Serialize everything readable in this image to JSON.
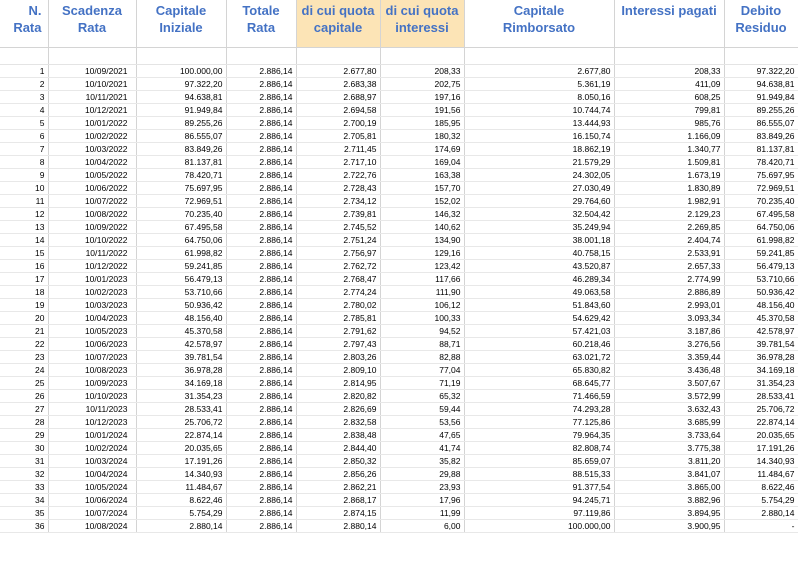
{
  "headers": [
    [
      "N.",
      "Rata"
    ],
    [
      "Scadenza",
      "Rata"
    ],
    [
      "Capitale",
      "Iniziale"
    ],
    [
      "Totale",
      "Rata"
    ],
    [
      "di cui quota",
      "capitale"
    ],
    [
      "di cui quota",
      "interessi"
    ],
    [
      "Capitale",
      "Rimborsato"
    ],
    [
      "Interessi pagati",
      ""
    ],
    [
      "Debito",
      "Residuo"
    ]
  ],
  "highlight_color": "#fce4b6",
  "header_color": "#4472c4",
  "rows": [
    [
      "1",
      "10/09/2021",
      "100.000,00",
      "2.886,14",
      "2.677,80",
      "208,33",
      "2.677,80",
      "208,33",
      "97.322,20"
    ],
    [
      "2",
      "10/10/2021",
      "97.322,20",
      "2.886,14",
      "2.683,38",
      "202,75",
      "5.361,19",
      "411,09",
      "94.638,81"
    ],
    [
      "3",
      "10/11/2021",
      "94.638,81",
      "2.886,14",
      "2.688,97",
      "197,16",
      "8.050,16",
      "608,25",
      "91.949,84"
    ],
    [
      "4",
      "10/12/2021",
      "91.949,84",
      "2.886,14",
      "2.694,58",
      "191,56",
      "10.744,74",
      "799,81",
      "89.255,26"
    ],
    [
      "5",
      "10/01/2022",
      "89.255,26",
      "2.886,14",
      "2.700,19",
      "185,95",
      "13.444,93",
      "985,76",
      "86.555,07"
    ],
    [
      "6",
      "10/02/2022",
      "86.555,07",
      "2.886,14",
      "2.705,81",
      "180,32",
      "16.150,74",
      "1.166,09",
      "83.849,26"
    ],
    [
      "7",
      "10/03/2022",
      "83.849,26",
      "2.886,14",
      "2.711,45",
      "174,69",
      "18.862,19",
      "1.340,77",
      "81.137,81"
    ],
    [
      "8",
      "10/04/2022",
      "81.137,81",
      "2.886,14",
      "2.717,10",
      "169,04",
      "21.579,29",
      "1.509,81",
      "78.420,71"
    ],
    [
      "9",
      "10/05/2022",
      "78.420,71",
      "2.886,14",
      "2.722,76",
      "163,38",
      "24.302,05",
      "1.673,19",
      "75.697,95"
    ],
    [
      "10",
      "10/06/2022",
      "75.697,95",
      "2.886,14",
      "2.728,43",
      "157,70",
      "27.030,49",
      "1.830,89",
      "72.969,51"
    ],
    [
      "11",
      "10/07/2022",
      "72.969,51",
      "2.886,14",
      "2.734,12",
      "152,02",
      "29.764,60",
      "1.982,91",
      "70.235,40"
    ],
    [
      "12",
      "10/08/2022",
      "70.235,40",
      "2.886,14",
      "2.739,81",
      "146,32",
      "32.504,42",
      "2.129,23",
      "67.495,58"
    ],
    [
      "13",
      "10/09/2022",
      "67.495,58",
      "2.886,14",
      "2.745,52",
      "140,62",
      "35.249,94",
      "2.269,85",
      "64.750,06"
    ],
    [
      "14",
      "10/10/2022",
      "64.750,06",
      "2.886,14",
      "2.751,24",
      "134,90",
      "38.001,18",
      "2.404,74",
      "61.998,82"
    ],
    [
      "15",
      "10/11/2022",
      "61.998,82",
      "2.886,14",
      "2.756,97",
      "129,16",
      "40.758,15",
      "2.533,91",
      "59.241,85"
    ],
    [
      "16",
      "10/12/2022",
      "59.241,85",
      "2.886,14",
      "2.762,72",
      "123,42",
      "43.520,87",
      "2.657,33",
      "56.479,13"
    ],
    [
      "17",
      "10/01/2023",
      "56.479,13",
      "2.886,14",
      "2.768,47",
      "117,66",
      "46.289,34",
      "2.774,99",
      "53.710,66"
    ],
    [
      "18",
      "10/02/2023",
      "53.710,66",
      "2.886,14",
      "2.774,24",
      "111,90",
      "49.063,58",
      "2.886,89",
      "50.936,42"
    ],
    [
      "19",
      "10/03/2023",
      "50.936,42",
      "2.886,14",
      "2.780,02",
      "106,12",
      "51.843,60",
      "2.993,01",
      "48.156,40"
    ],
    [
      "20",
      "10/04/2023",
      "48.156,40",
      "2.886,14",
      "2.785,81",
      "100,33",
      "54.629,42",
      "3.093,34",
      "45.370,58"
    ],
    [
      "21",
      "10/05/2023",
      "45.370,58",
      "2.886,14",
      "2.791,62",
      "94,52",
      "57.421,03",
      "3.187,86",
      "42.578,97"
    ],
    [
      "22",
      "10/06/2023",
      "42.578,97",
      "2.886,14",
      "2.797,43",
      "88,71",
      "60.218,46",
      "3.276,56",
      "39.781,54"
    ],
    [
      "23",
      "10/07/2023",
      "39.781,54",
      "2.886,14",
      "2.803,26",
      "82,88",
      "63.021,72",
      "3.359,44",
      "36.978,28"
    ],
    [
      "24",
      "10/08/2023",
      "36.978,28",
      "2.886,14",
      "2.809,10",
      "77,04",
      "65.830,82",
      "3.436,48",
      "34.169,18"
    ],
    [
      "25",
      "10/09/2023",
      "34.169,18",
      "2.886,14",
      "2.814,95",
      "71,19",
      "68.645,77",
      "3.507,67",
      "31.354,23"
    ],
    [
      "26",
      "10/10/2023",
      "31.354,23",
      "2.886,14",
      "2.820,82",
      "65,32",
      "71.466,59",
      "3.572,99",
      "28.533,41"
    ],
    [
      "27",
      "10/11/2023",
      "28.533,41",
      "2.886,14",
      "2.826,69",
      "59,44",
      "74.293,28",
      "3.632,43",
      "25.706,72"
    ],
    [
      "28",
      "10/12/2023",
      "25.706,72",
      "2.886,14",
      "2.832,58",
      "53,56",
      "77.125,86",
      "3.685,99",
      "22.874,14"
    ],
    [
      "29",
      "10/01/2024",
      "22.874,14",
      "2.886,14",
      "2.838,48",
      "47,65",
      "79.964,35",
      "3.733,64",
      "20.035,65"
    ],
    [
      "30",
      "10/02/2024",
      "20.035,65",
      "2.886,14",
      "2.844,40",
      "41,74",
      "82.808,74",
      "3.775,38",
      "17.191,26"
    ],
    [
      "31",
      "10/03/2024",
      "17.191,26",
      "2.886,14",
      "2.850,32",
      "35,82",
      "85.659,07",
      "3.811,20",
      "14.340,93"
    ],
    [
      "32",
      "10/04/2024",
      "14.340,93",
      "2.886,14",
      "2.856,26",
      "29,88",
      "88.515,33",
      "3.841,07",
      "11.484,67"
    ],
    [
      "33",
      "10/05/2024",
      "11.484,67",
      "2.886,14",
      "2.862,21",
      "23,93",
      "91.377,54",
      "3.865,00",
      "8.622,46"
    ],
    [
      "34",
      "10/06/2024",
      "8.622,46",
      "2.886,14",
      "2.868,17",
      "17,96",
      "94.245,71",
      "3.882,96",
      "5.754,29"
    ],
    [
      "35",
      "10/07/2024",
      "5.754,29",
      "2.886,14",
      "2.874,15",
      "11,99",
      "97.119,86",
      "3.894,95",
      "2.880,14"
    ],
    [
      "36",
      "10/08/2024",
      "2.880,14",
      "2.886,14",
      "2.880,14",
      "6,00",
      "100.000,00",
      "3.900,95",
      "-"
    ]
  ]
}
